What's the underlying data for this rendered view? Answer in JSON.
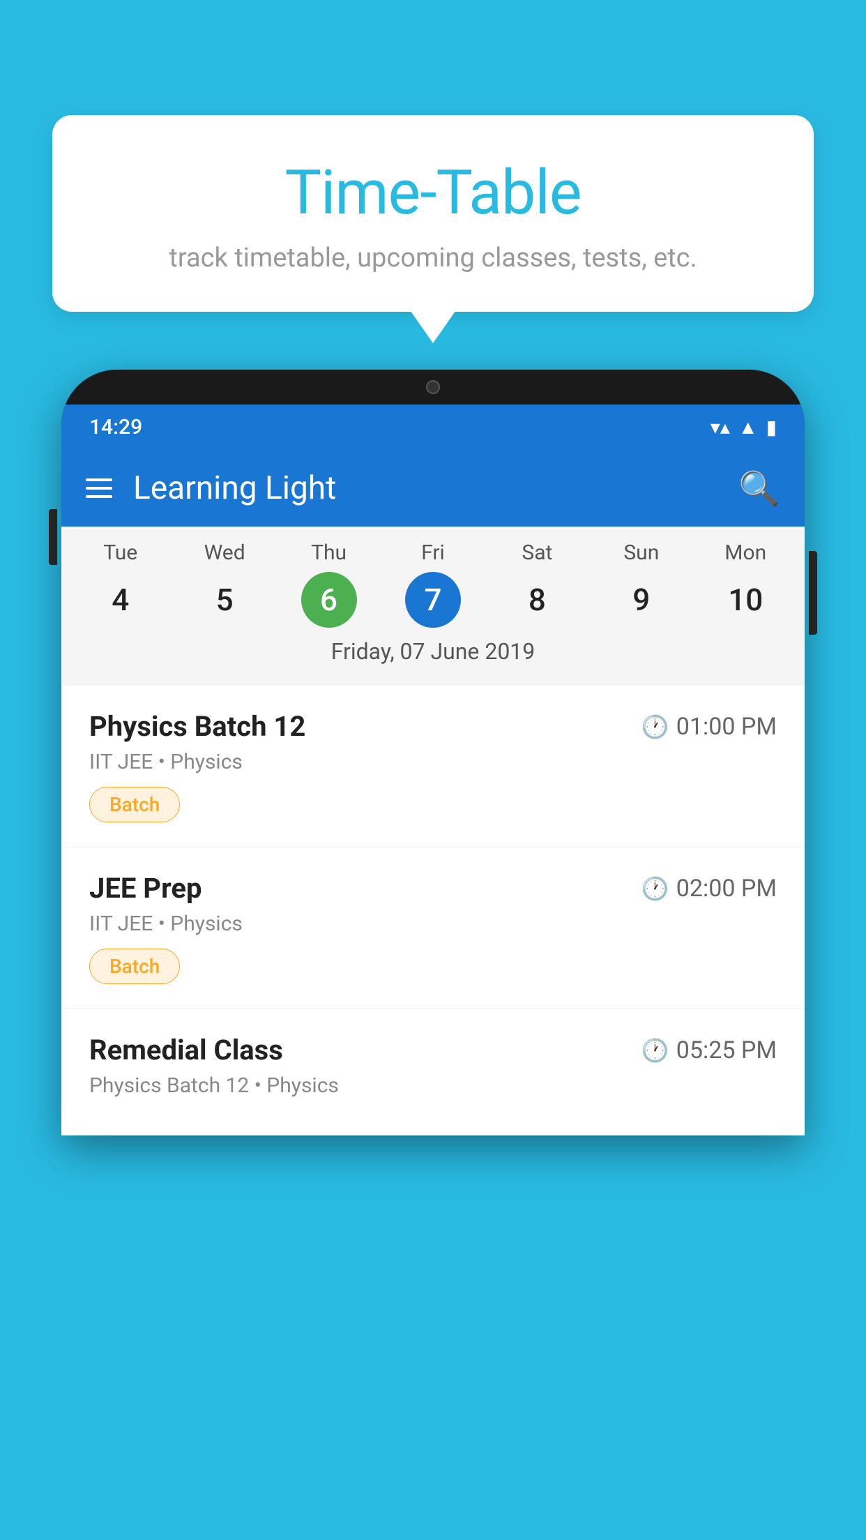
{
  "background_color": "#29BAE2",
  "hero_card": {
    "title": "Time-Table",
    "subtitle": "track timetable, upcoming classes, tests, etc."
  },
  "phone": {
    "status_bar": {
      "time": "14:29",
      "wifi_icon": "▼▲",
      "signal_icon": "▲",
      "battery_icon": "▮"
    },
    "app_bar": {
      "title": "Learning Light",
      "menu_icon": "hamburger",
      "search_icon": "🔍"
    },
    "calendar": {
      "days": [
        {
          "name": "Tue",
          "num": "4",
          "state": "normal"
        },
        {
          "name": "Wed",
          "num": "5",
          "state": "normal"
        },
        {
          "name": "Thu",
          "num": "6",
          "state": "today"
        },
        {
          "name": "Fri",
          "num": "7",
          "state": "selected"
        },
        {
          "name": "Sat",
          "num": "8",
          "state": "normal"
        },
        {
          "name": "Sun",
          "num": "9",
          "state": "normal"
        },
        {
          "name": "Mon",
          "num": "10",
          "state": "normal"
        }
      ],
      "selected_date_label": "Friday, 07 June 2019"
    },
    "classes": [
      {
        "name": "Physics Batch 12",
        "time": "01:00 PM",
        "subject": "IIT JEE • Physics",
        "tag": "Batch"
      },
      {
        "name": "JEE Prep",
        "time": "02:00 PM",
        "subject": "IIT JEE • Physics",
        "tag": "Batch"
      },
      {
        "name": "Remedial Class",
        "time": "05:25 PM",
        "subject": "Physics Batch 12 • Physics",
        "tag": ""
      }
    ]
  }
}
